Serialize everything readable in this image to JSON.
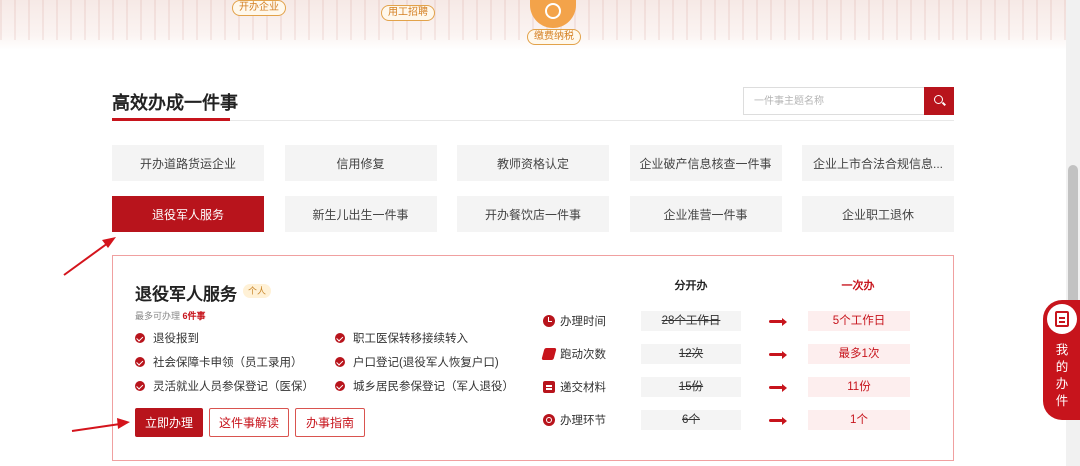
{
  "top_banner": {
    "pills": [
      "开办企业",
      "用工招聘",
      "缴费纳税"
    ]
  },
  "section": {
    "title": "高效办成一件事",
    "search_placeholder": "一件事主题名称"
  },
  "grid_items": [
    "开办道路货运企业",
    "信用修复",
    "教师资格认定",
    "企业破产信息核查一件事",
    "企业上市合法合规信息...",
    "退役军人服务",
    "新生儿出生一件事",
    "开办餐饮店一件事",
    "企业准营一件事",
    "企业职工退休"
  ],
  "active_item_index": 5,
  "panel": {
    "title": "退役军人服务",
    "tag": "个人",
    "max_prefix": "最多可办理",
    "max_count": "6件事",
    "items": [
      "退役报到",
      "职工医保转移接续转入",
      "社会保障卡申领（员工录用）",
      "户口登记(退役军人恢复户口)",
      "灵活就业人员参保登记（医保）",
      "城乡居民参保登记（军人退役）"
    ],
    "buttons": {
      "primary": "立即办理",
      "read": "这件事解读",
      "guide": "办事指南"
    },
    "compare": {
      "head_separate": "分开办",
      "head_once": "一次办",
      "rows": [
        {
          "icon": "clock-icon",
          "label": "办理时间",
          "old": "28个工作日",
          "new": "5个工作日"
        },
        {
          "icon": "running-icon",
          "label": "跑动次数",
          "old": "12次",
          "new": "最多1次"
        },
        {
          "icon": "document-icon",
          "label": "递交材料",
          "old": "15份",
          "new": "11份"
        },
        {
          "icon": "cycle-icon",
          "label": "办理环节",
          "old": "6个",
          "new": "1个"
        }
      ]
    }
  },
  "side_button": {
    "label": "我\n的\n办\n件"
  },
  "colors": {
    "brand_red": "#b8141c",
    "accent_orange": "#f3a34a",
    "panel_border": "#f0a0a0"
  }
}
